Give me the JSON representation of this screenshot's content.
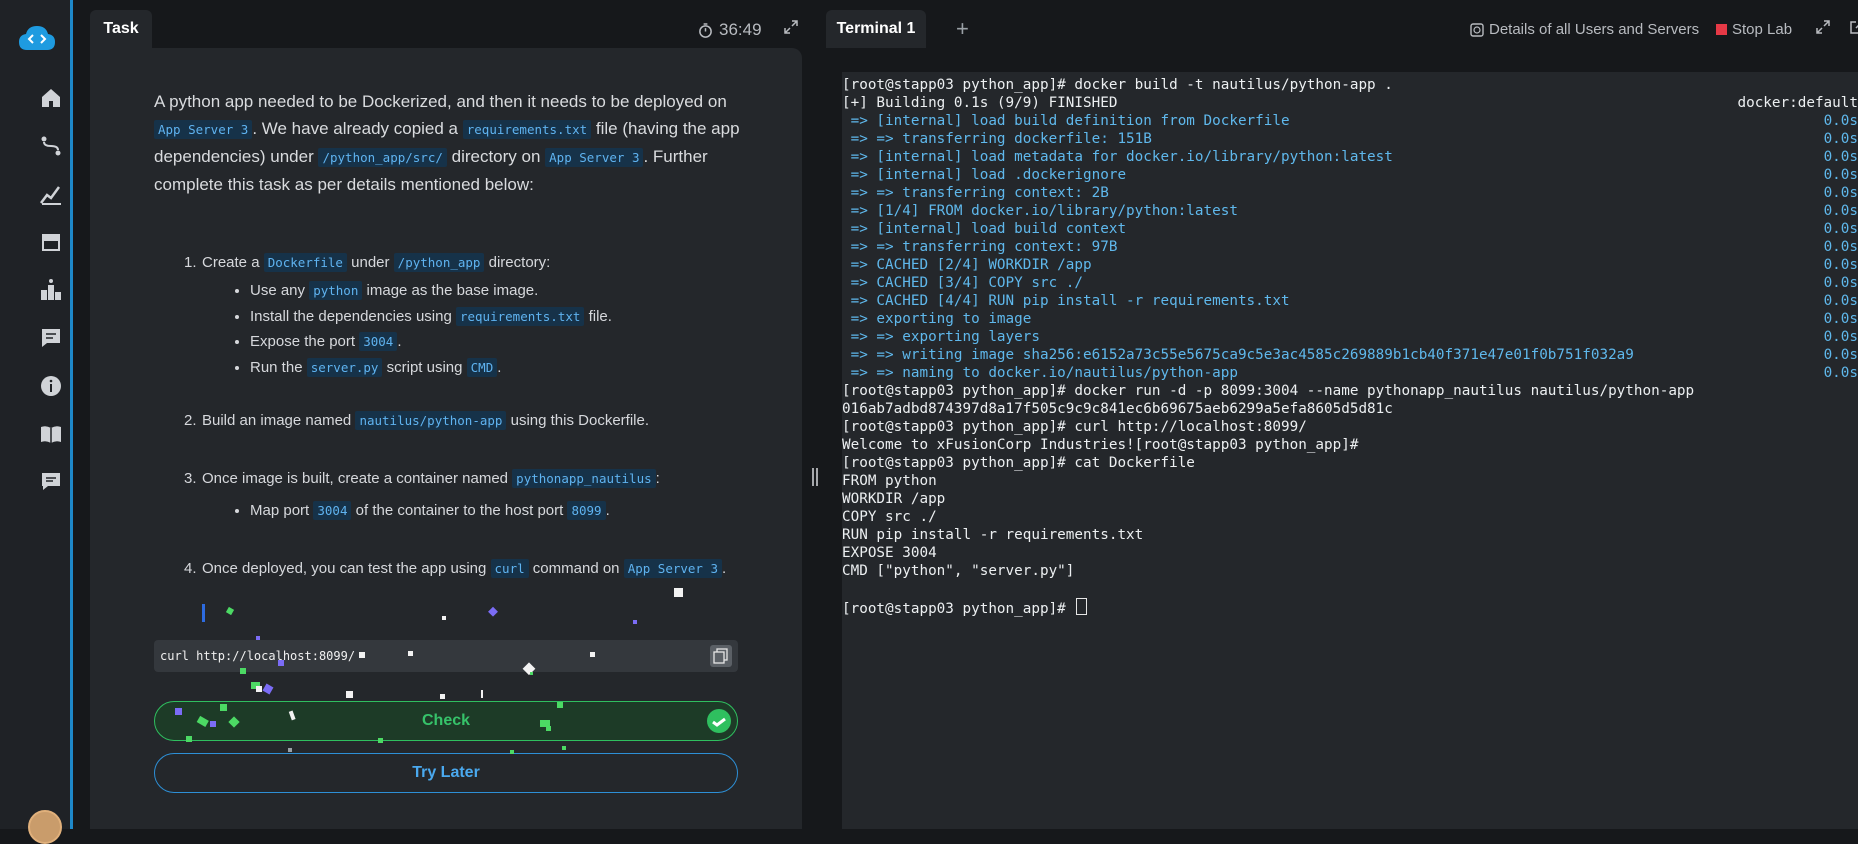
{
  "sidebar": {
    "items": [
      {
        "icon": "home-icon"
      },
      {
        "icon": "path-icon"
      },
      {
        "icon": "chart-icon"
      },
      {
        "icon": "store-icon"
      },
      {
        "icon": "leaderboard-icon"
      },
      {
        "icon": "feedback-icon"
      },
      {
        "icon": "info-icon"
      },
      {
        "icon": "docs-icon"
      },
      {
        "icon": "chat-icon"
      }
    ]
  },
  "task": {
    "tab_label": "Task",
    "timer": "36:49",
    "intro": {
      "p1": "A python app needed to be Dockerized, and then it needs to be deployed on ",
      "c1": "App Server 3",
      "p2": ". We have already copied a ",
      "c2": "requirements.txt",
      "p3": " file (having the app dependencies) under ",
      "c3": "/python_app/src/",
      "p4": " directory on ",
      "c4": "App Server 3",
      "p5": ". Further complete this task as per details mentioned below:"
    },
    "steps": {
      "s1": {
        "num": "1.",
        "a": "Create a ",
        "c1": "Dockerfile",
        "b": " under ",
        "c2": "/python_app",
        "d": " directory:",
        "subs": {
          "i1": {
            "a": "Use any ",
            "c": "python",
            "b": " image as the base image."
          },
          "i2": {
            "a": "Install the dependencies using ",
            "c": "requirements.txt",
            "b": " file."
          },
          "i3": {
            "a": "Expose the port ",
            "c": "3004",
            "b": "."
          },
          "i4": {
            "a": "Run the ",
            "c": "server.py",
            "b": " script using ",
            "c2": "CMD",
            "d": "."
          }
        }
      },
      "s2": {
        "num": "2.",
        "a": "Build an image named ",
        "c": "nautilus/python-app",
        "b": " using this Dockerfile."
      },
      "s3": {
        "num": "3.",
        "a": "Once image is built, create a container named ",
        "c": "pythonapp_nautilus",
        "b": ":",
        "subs": {
          "i1": {
            "a": "Map port ",
            "c": "3004",
            "b": " of the container to the host port ",
            "c2": "8099",
            "d": "."
          }
        }
      },
      "s4": {
        "num": "4.",
        "a": "Once deployed, you can test the app using ",
        "c": "curl",
        "b": " command on ",
        "c2": "App Server 3",
        "d": "."
      }
    },
    "command": "curl http://localhost:8099/",
    "check_label": "Check",
    "try_later_label": "Try Later"
  },
  "terminal": {
    "tab_label": "Terminal 1",
    "add_tab": "+",
    "details_link": "Details of all Users and Servers",
    "stop_lab": "Stop Lab",
    "lines": [
      {
        "t": "[root@stapp03 python_app]# docker build -t nautilus/python-app .",
        "c": "white",
        "r": ""
      },
      {
        "t": "[+] Building 0.1s (9/9) FINISHED",
        "c": "white",
        "r": "docker:default"
      },
      {
        "t": " => [internal] load build definition from Dockerfile",
        "c": "blue",
        "r": "0.0s"
      },
      {
        "t": " => => transferring dockerfile: 151B",
        "c": "blue",
        "r": "0.0s"
      },
      {
        "t": " => [internal] load metadata for docker.io/library/python:latest",
        "c": "blue",
        "r": "0.0s"
      },
      {
        "t": " => [internal] load .dockerignore",
        "c": "blue",
        "r": "0.0s"
      },
      {
        "t": " => => transferring context: 2B",
        "c": "blue",
        "r": "0.0s"
      },
      {
        "t": " => [1/4] FROM docker.io/library/python:latest",
        "c": "blue",
        "r": "0.0s"
      },
      {
        "t": " => [internal] load build context",
        "c": "blue",
        "r": "0.0s"
      },
      {
        "t": " => => transferring context: 97B",
        "c": "blue",
        "r": "0.0s"
      },
      {
        "t": " => CACHED [2/4] WORKDIR /app",
        "c": "blue",
        "r": "0.0s"
      },
      {
        "t": " => CACHED [3/4] COPY src ./",
        "c": "blue",
        "r": "0.0s"
      },
      {
        "t": " => CACHED [4/4] RUN pip install -r requirements.txt",
        "c": "blue",
        "r": "0.0s"
      },
      {
        "t": " => exporting to image",
        "c": "blue",
        "r": "0.0s"
      },
      {
        "t": " => => exporting layers",
        "c": "blue",
        "r": "0.0s"
      },
      {
        "t": " => => writing image sha256:e6152a73c55e5675ca9c5e3ac4585c269889b1cb40f371e47e01f0b751f032a9",
        "c": "blue",
        "r": "0.0s"
      },
      {
        "t": " => => naming to docker.io/nautilus/python-app",
        "c": "blue",
        "r": "0.0s"
      },
      {
        "t": "[root@stapp03 python_app]# docker run -d -p 8099:3004 --name pythonapp_nautilus nautilus/python-app",
        "c": "white",
        "r": ""
      },
      {
        "t": "016ab7adbd874397d8a17f505c9c9c841ec6b69675aeb6299a5efa8605d5d81c",
        "c": "white",
        "r": ""
      },
      {
        "t": "[root@stapp03 python_app]# curl http://localhost:8099/",
        "c": "white",
        "r": ""
      },
      {
        "t": "Welcome to xFusionCorp Industries![root@stapp03 python_app]#",
        "c": "white",
        "r": ""
      },
      {
        "t": "[root@stapp03 python_app]# cat Dockerfile",
        "c": "white",
        "r": ""
      },
      {
        "t": "FROM python",
        "c": "white",
        "r": ""
      },
      {
        "t": "WORKDIR /app",
        "c": "white",
        "r": ""
      },
      {
        "t": "COPY src ./",
        "c": "white",
        "r": ""
      },
      {
        "t": "RUN pip install -r requirements.txt",
        "c": "white",
        "r": ""
      },
      {
        "t": "EXPOSE 3004",
        "c": "white",
        "r": ""
      },
      {
        "t": "CMD [\"python\", \"server.py\"]",
        "c": "white",
        "r": ""
      },
      {
        "t": "",
        "c": "white",
        "r": ""
      }
    ],
    "prompt": "[root@stapp03 python_app]# "
  }
}
